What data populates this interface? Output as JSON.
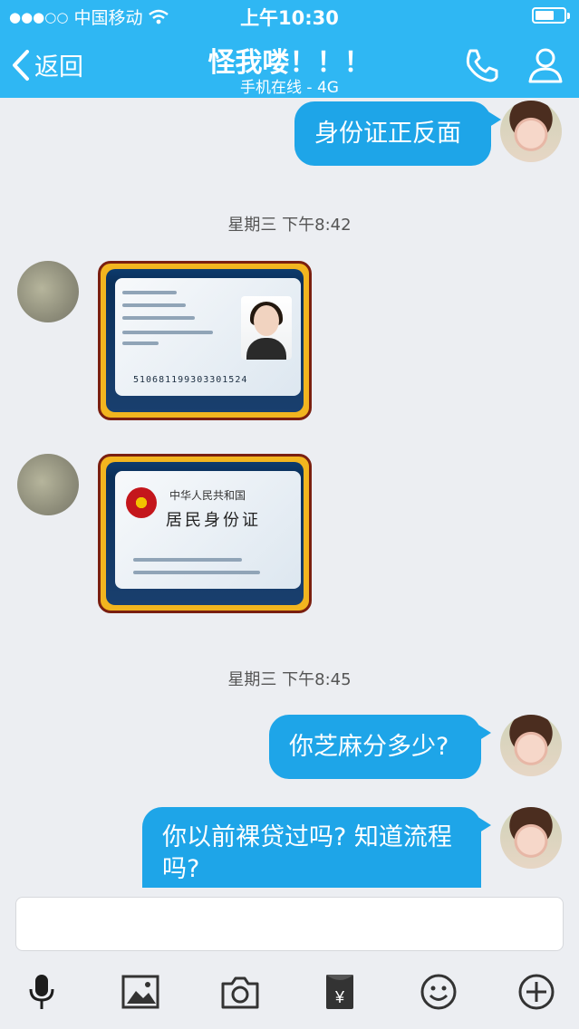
{
  "status": {
    "carrier": "中国移动",
    "time": "上午10:30",
    "signal_dots": "●●●○○",
    "battery_level": 0.65
  },
  "nav": {
    "back_label": "返回",
    "title": "怪我喽！！！",
    "subtitle": "手机在线 - 4G",
    "icons": [
      "phone-icon",
      "profile-icon"
    ]
  },
  "messages": [
    {
      "side": "me",
      "type": "text",
      "text": "身份证正反面"
    },
    {
      "type": "timestamp",
      "text": "星期三 下午8:42"
    },
    {
      "side": "other",
      "type": "image",
      "kind": "id-front",
      "id_number": "510681199303301524"
    },
    {
      "side": "other",
      "type": "image",
      "kind": "id-back",
      "title_small": "中华人民共和国",
      "title_big": "居民身份证"
    },
    {
      "type": "timestamp",
      "text": "星期三 下午8:45"
    },
    {
      "side": "me",
      "type": "text",
      "text": "你芝麻分多少?"
    },
    {
      "side": "me",
      "type": "text",
      "text": "你以前裸贷过吗? 知道流程吗?"
    }
  ],
  "input": {
    "placeholder": ""
  },
  "toolbar": {
    "icons": [
      "microphone-icon",
      "image-icon",
      "camera-icon",
      "red-packet-icon",
      "emoji-icon",
      "plus-icon"
    ]
  },
  "colors": {
    "brand": "#2fb7f3",
    "bubble": "#1ea5e8",
    "background": "#eceef2"
  }
}
